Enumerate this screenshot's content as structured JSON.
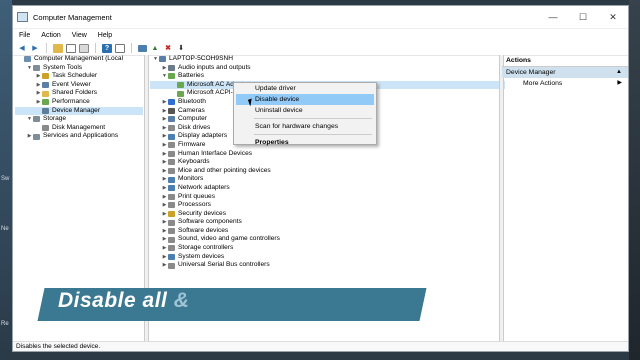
{
  "window": {
    "title": "Computer Management",
    "min_icon": "minimize-icon",
    "max_icon": "maximize-icon",
    "close_icon": "close-icon",
    "min_glyph": "—",
    "max_glyph": "☐",
    "close_glyph": "✕"
  },
  "menu": [
    "File",
    "Action",
    "View",
    "Help"
  ],
  "toolbar": [
    "back-icon",
    "forward-icon",
    "up-icon",
    "show-tree-icon",
    "properties-icon",
    "help-icon",
    "console-icon",
    "update-driver-icon",
    "uninstall-icon",
    "disable-icon"
  ],
  "tree": [
    {
      "label": "Computer Management (Local",
      "exp": "",
      "indent": 0,
      "icon": "#6b8fb0"
    },
    {
      "label": "System Tools",
      "exp": "▼",
      "indent": 1,
      "icon": "#7f8c99"
    },
    {
      "label": "Task Scheduler",
      "exp": "▶",
      "indent": 2,
      "icon": "#c9a227"
    },
    {
      "label": "Event Viewer",
      "exp": "▶",
      "indent": 2,
      "icon": "#5a7fa6"
    },
    {
      "label": "Shared Folders",
      "exp": "▶",
      "indent": 2,
      "icon": "#e1b94a"
    },
    {
      "label": "Performance",
      "exp": "▶",
      "indent": 2,
      "icon": "#6aa84f"
    },
    {
      "label": "Device Manager",
      "exp": "",
      "indent": 2,
      "icon": "#5d7d99",
      "selected": true
    },
    {
      "label": "Storage",
      "exp": "▼",
      "indent": 1,
      "icon": "#7f8c99"
    },
    {
      "label": "Disk Management",
      "exp": "",
      "indent": 2,
      "icon": "#8a8a8a"
    },
    {
      "label": "Services and Applications",
      "exp": "▶",
      "indent": 1,
      "icon": "#7f8c99"
    }
  ],
  "devices": [
    {
      "label": "LAPTOP-5COH9SNH",
      "exp": "▼",
      "indent": 0,
      "icon": "#5a7fa6"
    },
    {
      "label": "Audio inputs and outputs",
      "exp": "▶",
      "indent": 1,
      "icon": "#6b7b8a"
    },
    {
      "label": "Batteries",
      "exp": "▼",
      "indent": 1,
      "icon": "#6aa84f"
    },
    {
      "label": "Microsoft AC Adapter",
      "exp": "",
      "indent": 2,
      "icon": "#6aa84f",
      "selected": true
    },
    {
      "label": "Microsoft ACPI-",
      "exp": "",
      "indent": 2,
      "icon": "#6aa84f"
    },
    {
      "label": "Bluetooth",
      "exp": "▶",
      "indent": 1,
      "icon": "#2f6fcf"
    },
    {
      "label": "Cameras",
      "exp": "▶",
      "indent": 1,
      "icon": "#555555"
    },
    {
      "label": "Computer",
      "exp": "▶",
      "indent": 1,
      "icon": "#5a7fa6"
    },
    {
      "label": "Disk drives",
      "exp": "▶",
      "indent": 1,
      "icon": "#8a8a8a"
    },
    {
      "label": "Display adapters",
      "exp": "▶",
      "indent": 1,
      "icon": "#4a7fb0"
    },
    {
      "label": "Firmware",
      "exp": "▶",
      "indent": 1,
      "icon": "#8a8a8a"
    },
    {
      "label": "Human Interface Devices",
      "exp": "▶",
      "indent": 1,
      "icon": "#8a8a8a"
    },
    {
      "label": "Keyboards",
      "exp": "▶",
      "indent": 1,
      "icon": "#8a8a8a"
    },
    {
      "label": "Mice and other pointing devices",
      "exp": "▶",
      "indent": 1,
      "icon": "#8a8a8a"
    },
    {
      "label": "Monitors",
      "exp": "▶",
      "indent": 1,
      "icon": "#4a7fb0"
    },
    {
      "label": "Network adapters",
      "exp": "▶",
      "indent": 1,
      "icon": "#4a7fb0"
    },
    {
      "label": "Print queues",
      "exp": "▶",
      "indent": 1,
      "icon": "#8a8a8a"
    },
    {
      "label": "Processors",
      "exp": "▶",
      "indent": 1,
      "icon": "#8a8a8a"
    },
    {
      "label": "Security devices",
      "exp": "▶",
      "indent": 1,
      "icon": "#c9a227"
    },
    {
      "label": "Software components",
      "exp": "▶",
      "indent": 1,
      "icon": "#8a8a8a"
    },
    {
      "label": "Software devices",
      "exp": "▶",
      "indent": 1,
      "icon": "#8a8a8a"
    },
    {
      "label": "Sound, video and game controllers",
      "exp": "▶",
      "indent": 1,
      "icon": "#8a8a8a"
    },
    {
      "label": "Storage controllers",
      "exp": "▶",
      "indent": 1,
      "icon": "#8a8a8a"
    },
    {
      "label": "System devices",
      "exp": "▶",
      "indent": 1,
      "icon": "#4a7fb0"
    },
    {
      "label": "Universal Serial Bus controllers",
      "exp": "▶",
      "indent": 1,
      "icon": "#8a8a8a"
    }
  ],
  "actions": {
    "header": "Actions",
    "section": "Device Manager",
    "section_arrow": "▲",
    "item": "More Actions",
    "item_arrow": "▶"
  },
  "context_menu": {
    "items": [
      {
        "label": "Update driver"
      },
      {
        "label": "Disable device",
        "highlighted": true
      },
      {
        "label": "Uninstall device"
      },
      {
        "sep": true
      },
      {
        "label": "Scan for hardware changes"
      },
      {
        "sep": true
      },
      {
        "label": "Properties",
        "bold": true
      }
    ]
  },
  "status": "Disables the selected device.",
  "overlay": {
    "text": "Disable all",
    "amp": "&"
  },
  "desktop_fragments": [
    "Sw",
    "Ne",
    "Re"
  ],
  "colors": {
    "selection": "#cce4f7",
    "menu_highlight": "#91c9f7",
    "overlay_bg": "#3b7891"
  }
}
